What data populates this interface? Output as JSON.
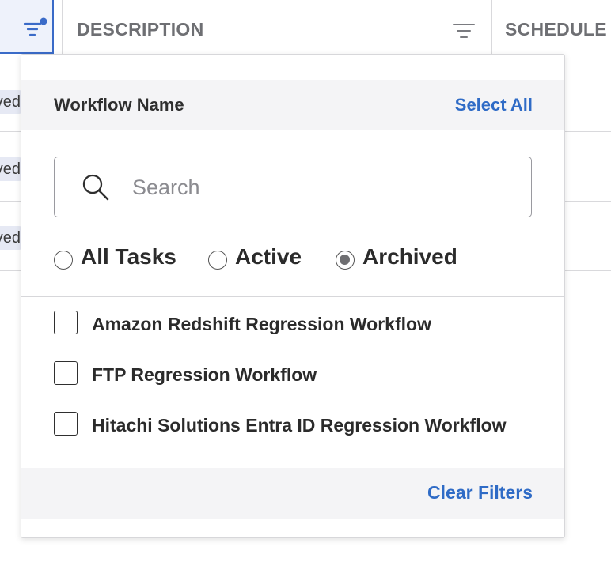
{
  "table": {
    "columns": [
      {
        "title": "DESCRIPTION",
        "icon": "filter-icon"
      },
      {
        "title": "SCHEDULE"
      }
    ],
    "rows": [
      {
        "status": "Archived"
      },
      {
        "status": "Archived"
      },
      {
        "status": "Archived"
      }
    ]
  },
  "filter_panel": {
    "title": "Workflow Name",
    "select_all_label": "Select All",
    "search": {
      "placeholder": "Search",
      "value": ""
    },
    "radio_options": [
      {
        "label": "All Tasks",
        "checked": false
      },
      {
        "label": "Active",
        "checked": false
      },
      {
        "label": "Archived",
        "checked": true
      }
    ],
    "items": [
      {
        "label": "Amazon Redshift Regression Workflow",
        "checked": false
      },
      {
        "label": "FTP Regression Workflow",
        "checked": false
      },
      {
        "label": "Hitachi Solutions Entra ID Regression Workflow",
        "checked": false
      }
    ],
    "clear_filters_label": "Clear Filters"
  },
  "colors": {
    "accent": "#2f6bc6",
    "active_filter_border": "#3a6bc8",
    "header_text": "#6e6f73",
    "panel_band": "#f4f4f6"
  }
}
